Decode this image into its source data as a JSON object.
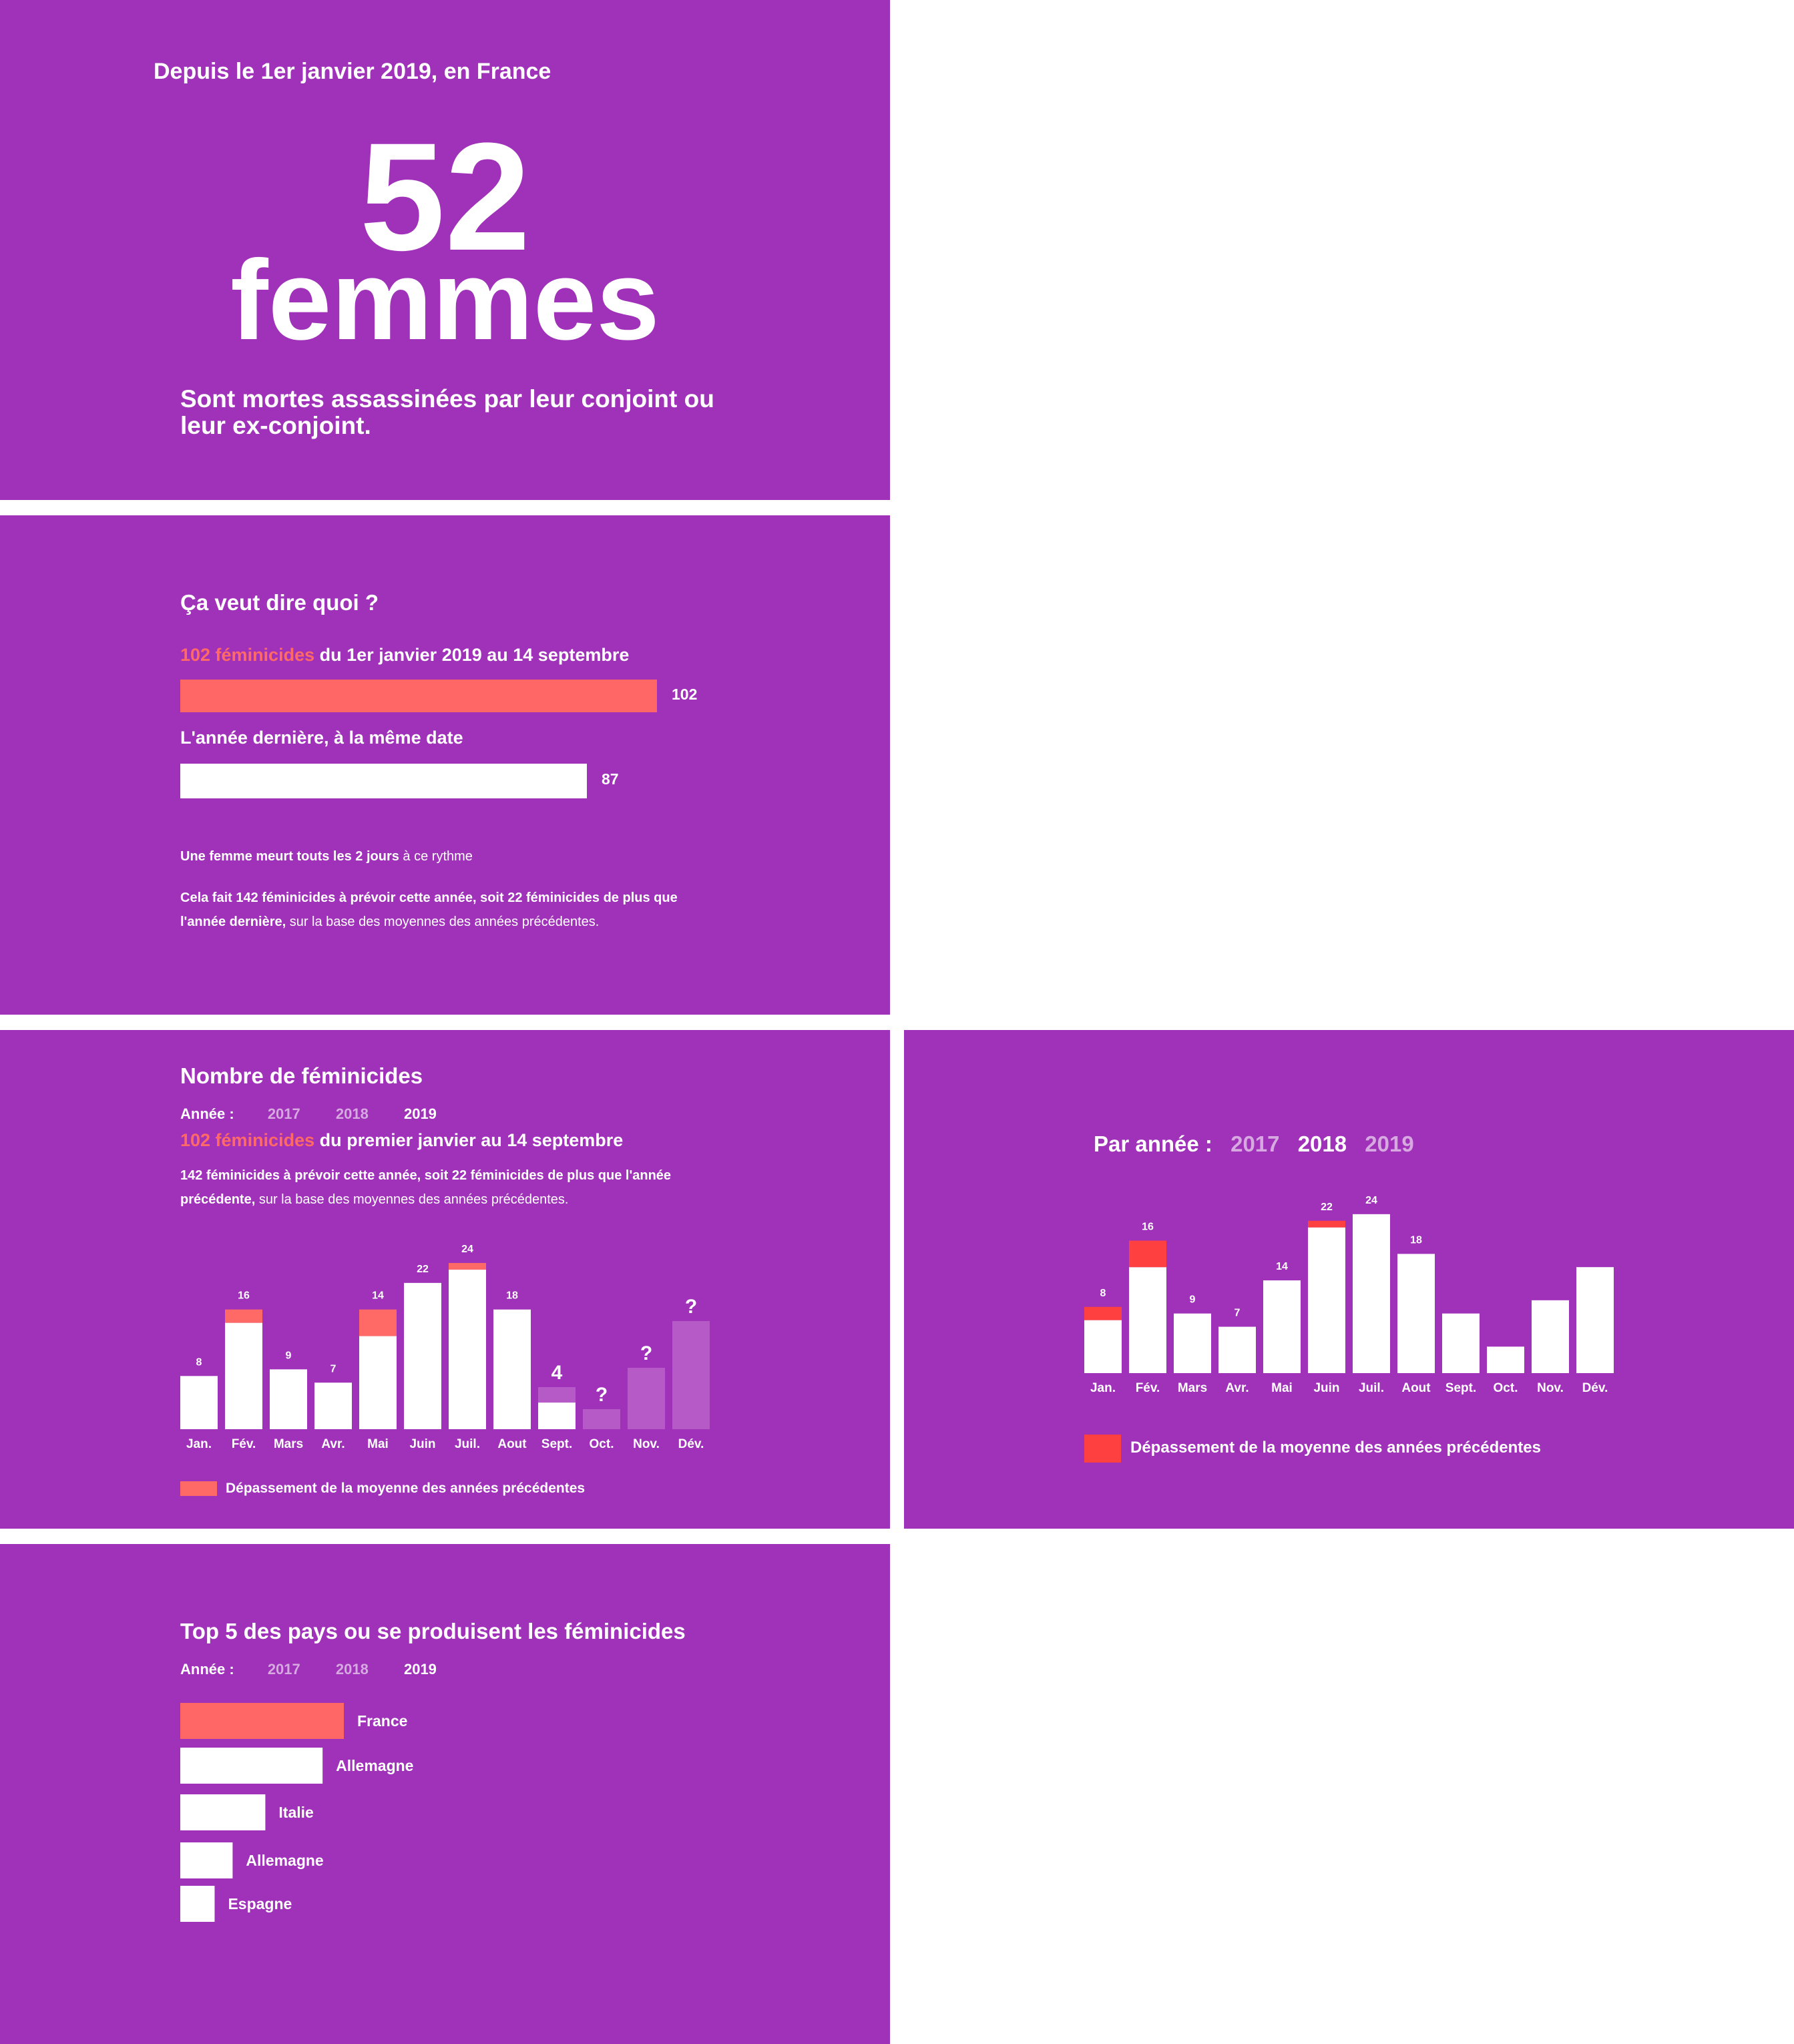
{
  "panel1": {
    "intro": "Depuis le 1er janvier 2019, en France",
    "number": "52",
    "word": "femmes",
    "subtitle": "Sont mortes assassinées par leur conjoint ou leur ex-conjoint."
  },
  "panel2": {
    "title": "Ça veut dire quoi ?",
    "line1_highlight": "102 féminicides",
    "line1_rest": " du 1er janvier 2019 au 14 septembre",
    "bar1_value": 102,
    "bar1_label": "102",
    "line2": "L'année dernière, à la même date",
    "bar2_value": 87,
    "bar2_label": "87",
    "rhythm_bold": "Une femme meurt touts les 2 jours",
    "rhythm_rest": " à ce rythme",
    "forecast_bold": "Cela fait 142 féminicides à prévoir cette année, soit 22 féminicides de plus que l'année dernière,",
    "forecast_rest": " sur la base des moyennes des années précédentes.",
    "colors": {
      "current": "#ff6666",
      "previous": "#ffffff"
    }
  },
  "panel3": {
    "title": "Nombre de féminicides",
    "year_label": "Année :",
    "years": [
      "2017",
      "2018",
      "2019"
    ],
    "selected_year": "2019",
    "highlight": "102 féminicides",
    "highlight_rest": " du premier janvier au 14 septembre",
    "desc_bold": "142 féminicides à prévoir cette année, soit 22 féminicides de plus que l'année précédente,",
    "desc_rest": " sur la base des moyennes des années précédentes.",
    "legend": "Dépassement  de la moyenne des années précédentes"
  },
  "panel4": {
    "year_label": "Par année :",
    "years": [
      "2017",
      "2018",
      "2019"
    ],
    "selected_year": "2018",
    "legend": "Dépassement  de la moyenne des années précédentes"
  },
  "panel5": {
    "title": "Top 5 des pays ou se produisent les féminicides",
    "year_label": "Année :",
    "years": [
      "2017",
      "2018",
      "2019"
    ],
    "selected_year": "2019"
  },
  "chart_data": [
    {
      "type": "bar",
      "id": "femicides-2019",
      "title": "Nombre de féminicides",
      "categories": [
        "Jan.",
        "Fév.",
        "Mars",
        "Avr.",
        "Mai",
        "Juin",
        "Juil.",
        "Aout",
        "Sept.",
        "Oct.",
        "Nov.",
        "Dév."
      ],
      "labels": [
        "8",
        "16",
        "9",
        "7",
        "14",
        "22",
        "24",
        "18",
        "4",
        "?",
        "?",
        "?"
      ],
      "series": [
        {
          "values": [
            8,
            16,
            9,
            7,
            14,
            22,
            24,
            18,
            4,
            null,
            null,
            null
          ]
        },
        {
          "name": "Dépassement  de la moyenne des années précédentes",
          "values": [
            0,
            2,
            0,
            0,
            4,
            0,
            1,
            0,
            0,
            0,
            0,
            0
          ]
        }
      ],
      "ylim": [
        0,
        26
      ],
      "colors": {
        "bar": "#ffffff",
        "excess": "#ff6a66",
        "projection": "#b65ac8"
      }
    },
    {
      "type": "bar",
      "id": "femicides-2018",
      "categories": [
        "Jan.",
        "Fév.",
        "Mars",
        "Avr.",
        "Mai",
        "Juin",
        "Juil.",
        "Aout",
        "Sept.",
        "Oct.",
        "Nov.",
        "Dév."
      ],
      "labels": [
        "8",
        "16",
        "9",
        "7",
        "14",
        "22",
        "24",
        "18",
        "",
        "",
        "",
        ""
      ],
      "series": [
        {
          "values": [
            8,
            16,
            9,
            7,
            14,
            22,
            24,
            18,
            9,
            4,
            11,
            16
          ]
        },
        {
          "name": "Dépassement  de la moyenne des années précédentes",
          "values": [
            2,
            4,
            0,
            0,
            0,
            1,
            0,
            0,
            0,
            0,
            0,
            0
          ]
        }
      ],
      "ylim": [
        0,
        26
      ],
      "colors": {
        "bar": "#ffffff",
        "excess": "#ff4040"
      }
    },
    {
      "type": "bar",
      "id": "top5-countries",
      "title": "Top 5 des pays ou se produisent les féminicides",
      "categories": [
        "France",
        "Allemagne",
        "Italie",
        "Allemagne",
        "Espagne"
      ],
      "values": [
        100,
        87,
        52,
        32,
        21
      ],
      "orientation": "horizontal",
      "colors": {
        "first": "#ff6666",
        "others": "#ffffff"
      }
    }
  ]
}
